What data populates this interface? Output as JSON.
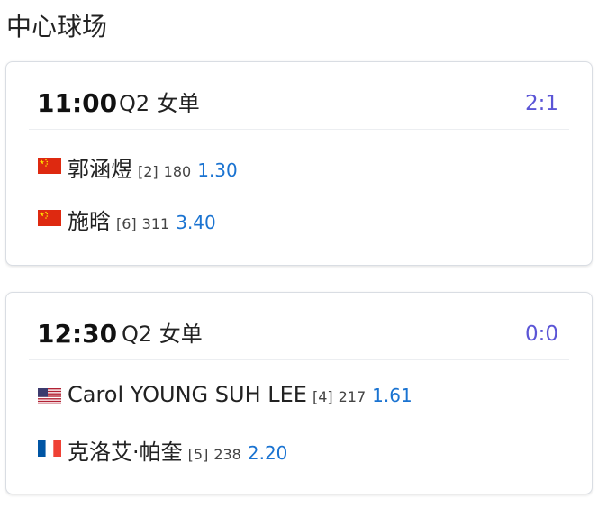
{
  "page": {
    "title": "中心球场"
  },
  "colors": {
    "score": "#5b55d6",
    "odds": "#1a73d1",
    "card_border": "#d9dde3"
  },
  "matches": [
    {
      "time": "11:00",
      "round": "Q2 女单",
      "score": "2:1",
      "players": [
        {
          "flag": "china-flag-icon",
          "name": "郭涵煜",
          "seed": "[2]",
          "rank": "180",
          "odds": "1.30"
        },
        {
          "flag": "china-flag-icon",
          "name": "施晗",
          "seed": "[6]",
          "rank": "311",
          "odds": "3.40"
        }
      ]
    },
    {
      "time": "12:30",
      "round": "Q2 女单",
      "score": "0:0",
      "players": [
        {
          "flag": "usa-flag-icon",
          "name": "Carol YOUNG SUH LEE",
          "seed": "[4]",
          "rank": "217",
          "odds": "1.61"
        },
        {
          "flag": "france-flag-icon",
          "name": "克洛艾·帕奎",
          "seed": "[5]",
          "rank": "238",
          "odds": "2.20"
        }
      ]
    }
  ]
}
